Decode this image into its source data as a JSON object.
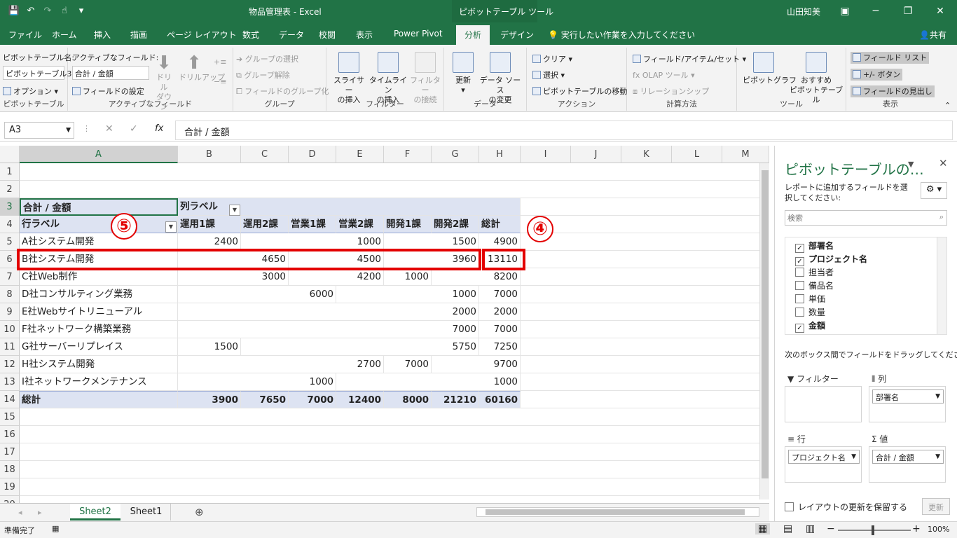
{
  "title_bar": {
    "doc_title": "物品管理表 - Excel",
    "context_tab": "ピボットテーブル ツール",
    "user": "山田知美"
  },
  "tabs": [
    "ファイル",
    "ホーム",
    "挿入",
    "描画",
    "ページ レイアウト",
    "数式",
    "データ",
    "校閲",
    "表示",
    "Power Pivot",
    "分析",
    "デザイン"
  ],
  "tell_me": "実行したい作業を入力してください",
  "share": "共有",
  "ribbon": {
    "pivottable": {
      "name_label": "ピボットテーブル名:",
      "name_value": "ピボットテーブル3",
      "options": "オプション",
      "group": "ピボットテーブル"
    },
    "active_field": {
      "label": "アクティブなフィールド:",
      "value": "合計 / 金額",
      "settings": "フィールドの設定",
      "drill_down": "ドリル\nダウン",
      "drill_up": "ドリルアップ",
      "group": "アクティブなフィールド"
    },
    "group_g": {
      "select": "グループの選択",
      "ungroup": "グループ解除",
      "group_field": "フィールドのグループ化",
      "group": "グループ"
    },
    "filter": {
      "slicer": "スライサー\nの挿入",
      "timeline": "タイムライン\nの挿入",
      "connect": "フィルター\nの接続",
      "group": "フィルター"
    },
    "data": {
      "refresh": "更新",
      "change_source": "データ ソース\nの変更",
      "group": "データ"
    },
    "actions": {
      "clear": "クリア",
      "select": "選択",
      "move": "ピボットテーブルの移動",
      "group": "アクション"
    },
    "calc": {
      "fields_items": "フィールド/アイテム/セット",
      "olap": "OLAP ツール",
      "relationships": "リレーションシップ",
      "group": "計算方法"
    },
    "tools": {
      "pivotchart": "ピボットグラフ",
      "recommended": "おすすめ\nピボットテーブル",
      "group": "ツール"
    },
    "show": {
      "field_list": "フィールド リスト",
      "buttons": "+/- ボタン",
      "headers": "フィールドの見出し",
      "group": "表示"
    }
  },
  "formula_bar": {
    "name_box": "A3",
    "formula": "合計 / 金額"
  },
  "columns": [
    "A",
    "B",
    "C",
    "D",
    "E",
    "F",
    "G",
    "H",
    "I",
    "J",
    "K",
    "L",
    "M"
  ],
  "rows": [
    "1",
    "2",
    "3",
    "4",
    "5",
    "6",
    "7",
    "8",
    "9",
    "10",
    "11",
    "12",
    "13",
    "14",
    "15",
    "16",
    "17",
    "18",
    "19",
    "20"
  ],
  "pivot": {
    "sum_label": "合計 / 金額",
    "col_label": "列ラベル",
    "row_label": "行ラベル",
    "headers": [
      "運用1課",
      "運用2課",
      "営業1課",
      "営業2課",
      "開発1課",
      "開発2課",
      "総計"
    ],
    "rows": [
      {
        "name": "A社システム開発",
        "vals": [
          "2400",
          "",
          "",
          "1000",
          "",
          "1500",
          "4900"
        ]
      },
      {
        "name": "B社システム開発",
        "vals": [
          "",
          "4650",
          "",
          "4500",
          "",
          "3960",
          "13110"
        ]
      },
      {
        "name": "C社Web制作",
        "vals": [
          "",
          "3000",
          "",
          "4200",
          "1000",
          "",
          "8200"
        ]
      },
      {
        "name": "D社コンサルティング業務",
        "vals": [
          "",
          "",
          "6000",
          "",
          "",
          "1000",
          "7000"
        ]
      },
      {
        "name": "E社Webサイトリニューアル",
        "vals": [
          "",
          "",
          "",
          "",
          "",
          "2000",
          "2000"
        ]
      },
      {
        "name": "F社ネットワーク構築業務",
        "vals": [
          "",
          "",
          "",
          "",
          "",
          "7000",
          "7000"
        ]
      },
      {
        "name": "G社サーバーリプレイス",
        "vals": [
          "1500",
          "",
          "",
          "",
          "",
          "5750",
          "7250"
        ]
      },
      {
        "name": "H社システム開発",
        "vals": [
          "",
          "",
          "",
          "2700",
          "7000",
          "",
          "9700"
        ]
      },
      {
        "name": "I社ネットワークメンテナンス",
        "vals": [
          "",
          "",
          "1000",
          "",
          "",
          "",
          "1000"
        ]
      }
    ],
    "total": {
      "name": "総計",
      "vals": [
        "3900",
        "7650",
        "7000",
        "12400",
        "8000",
        "21210",
        "60160"
      ]
    }
  },
  "annotations": {
    "circle4": "④",
    "circle5": "⑤"
  },
  "sheet_tabs": [
    "Sheet2",
    "Sheet1"
  ],
  "status": {
    "ready": "準備完了",
    "zoom": "100%"
  },
  "field_pane": {
    "title": "ピボットテーブルの…",
    "instruction": "レポートに追加するフィールドを選択してください:",
    "search_placeholder": "検索",
    "fields": [
      {
        "name": "部署名",
        "checked": true
      },
      {
        "name": "プロジェクト名",
        "checked": true
      },
      {
        "name": "担当者",
        "checked": false
      },
      {
        "name": "備品名",
        "checked": false
      },
      {
        "name": "単価",
        "checked": false
      },
      {
        "name": "数量",
        "checked": false
      },
      {
        "name": "金額",
        "checked": true
      }
    ],
    "drag_hint": "次のボックス間でフィールドをドラッグしてください:",
    "areas": {
      "filter": "フィルター",
      "columns": "列",
      "rows": "行",
      "values": "値"
    },
    "columns_chip": "部署名",
    "rows_chip": "プロジェクト名",
    "values_chip": "合計 / 金額",
    "defer": "レイアウトの更新を保留する",
    "update": "更新"
  }
}
